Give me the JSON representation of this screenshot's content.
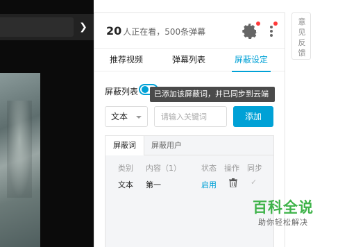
{
  "viewers": {
    "count": "20",
    "text": "人正在看，500条弹幕"
  },
  "tabs": [
    {
      "label": "推荐视频"
    },
    {
      "label": "弹幕列表"
    },
    {
      "label": "屏蔽设定"
    }
  ],
  "active_tab": "屏蔽设定",
  "block": {
    "label": "屏蔽列表",
    "toggle_on": true,
    "tooltip": "已添加该屏蔽词，并已同步到云端",
    "select_value": "文本",
    "input_placeholder": "请输入关键词",
    "add_label": "添加"
  },
  "list": {
    "sub_tabs": [
      "屏蔽词",
      "屏蔽用户"
    ],
    "columns": [
      "类别",
      "内容（1）",
      "状态",
      "操作",
      "同步"
    ],
    "rows": [
      {
        "type": "文本",
        "content": "第一",
        "status": "启用",
        "action_icon": "trash-icon",
        "sync_icon": "check-icon"
      }
    ]
  },
  "feedback": [
    "意",
    "见",
    "反",
    "馈"
  ],
  "watermark": {
    "title": "百科全说",
    "subtitle": "助你轻松解决"
  },
  "colors": {
    "accent": "#00a1d6",
    "badge": "#ff3a3a",
    "watermark": "#3fb34a"
  }
}
